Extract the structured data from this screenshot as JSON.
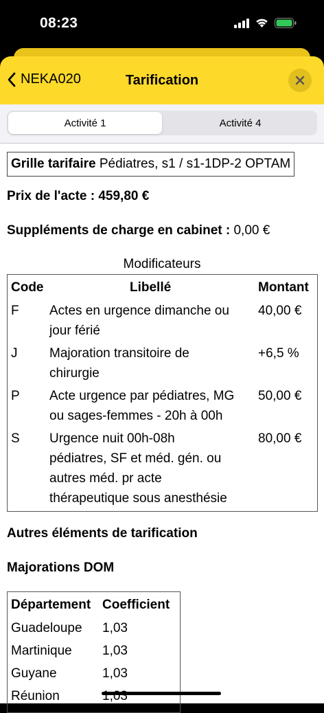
{
  "status_bar": {
    "time": "08:23"
  },
  "header": {
    "back_label": "NEKA020",
    "title": "Tarification"
  },
  "tabs": [
    {
      "label": "Activité 1",
      "active": true
    },
    {
      "label": "Activité 4",
      "active": false
    }
  ],
  "grille": {
    "label": "Grille tarifaire",
    "value": "Pédiatres, s1 / s1-1DP-2 OPTAM"
  },
  "prix": {
    "label": "Prix de l'acte :",
    "value": "459,80 €"
  },
  "supplements": {
    "label": "Suppléments de charge en cabinet :",
    "value": "0,00 €"
  },
  "modificateurs": {
    "title": "Modificateurs",
    "headers": {
      "code": "Code",
      "libelle": "Libellé",
      "montant": "Montant"
    },
    "rows": [
      {
        "code": "F",
        "libelle_lines": [
          "Actes en urgence dimanche ou",
          "jour férié"
        ],
        "montant": "40,00 €"
      },
      {
        "code": "J",
        "libelle_lines": [
          "Majoration transitoire de",
          "chirurgie"
        ],
        "montant": "+6,5 %"
      },
      {
        "code": "P",
        "libelle_lines": [
          "Acte urgence par pédiatres, MG",
          "ou sages-femmes - 20h à 00h"
        ],
        "montant": "50,00 €"
      },
      {
        "code": "S",
        "libelle_lines": [
          "Urgence nuit 00h-08h",
          "pédiatres, SF et méd. gén. ou",
          "autres méd. pr acte",
          "thérapeutique sous anesthésie"
        ],
        "montant": "80,00 €"
      }
    ]
  },
  "autres": {
    "label": "Autres éléments de tarification"
  },
  "dom": {
    "title": "Majorations DOM",
    "headers": {
      "departement": "Département",
      "coefficient": "Coefficient"
    },
    "rows": [
      {
        "departement": "Guadeloupe",
        "coefficient": "1,03"
      },
      {
        "departement": "Martinique",
        "coefficient": "1,03"
      },
      {
        "departement": "Guyane",
        "coefficient": "1,03"
      },
      {
        "departement": "Réunion",
        "coefficient": "1,03"
      }
    ]
  },
  "colors": {
    "header_yellow": "#fdd92a",
    "sheet_yellow": "#e9c21a",
    "battery_green": "#34c759",
    "segment_bg": "#e3e3e8"
  }
}
